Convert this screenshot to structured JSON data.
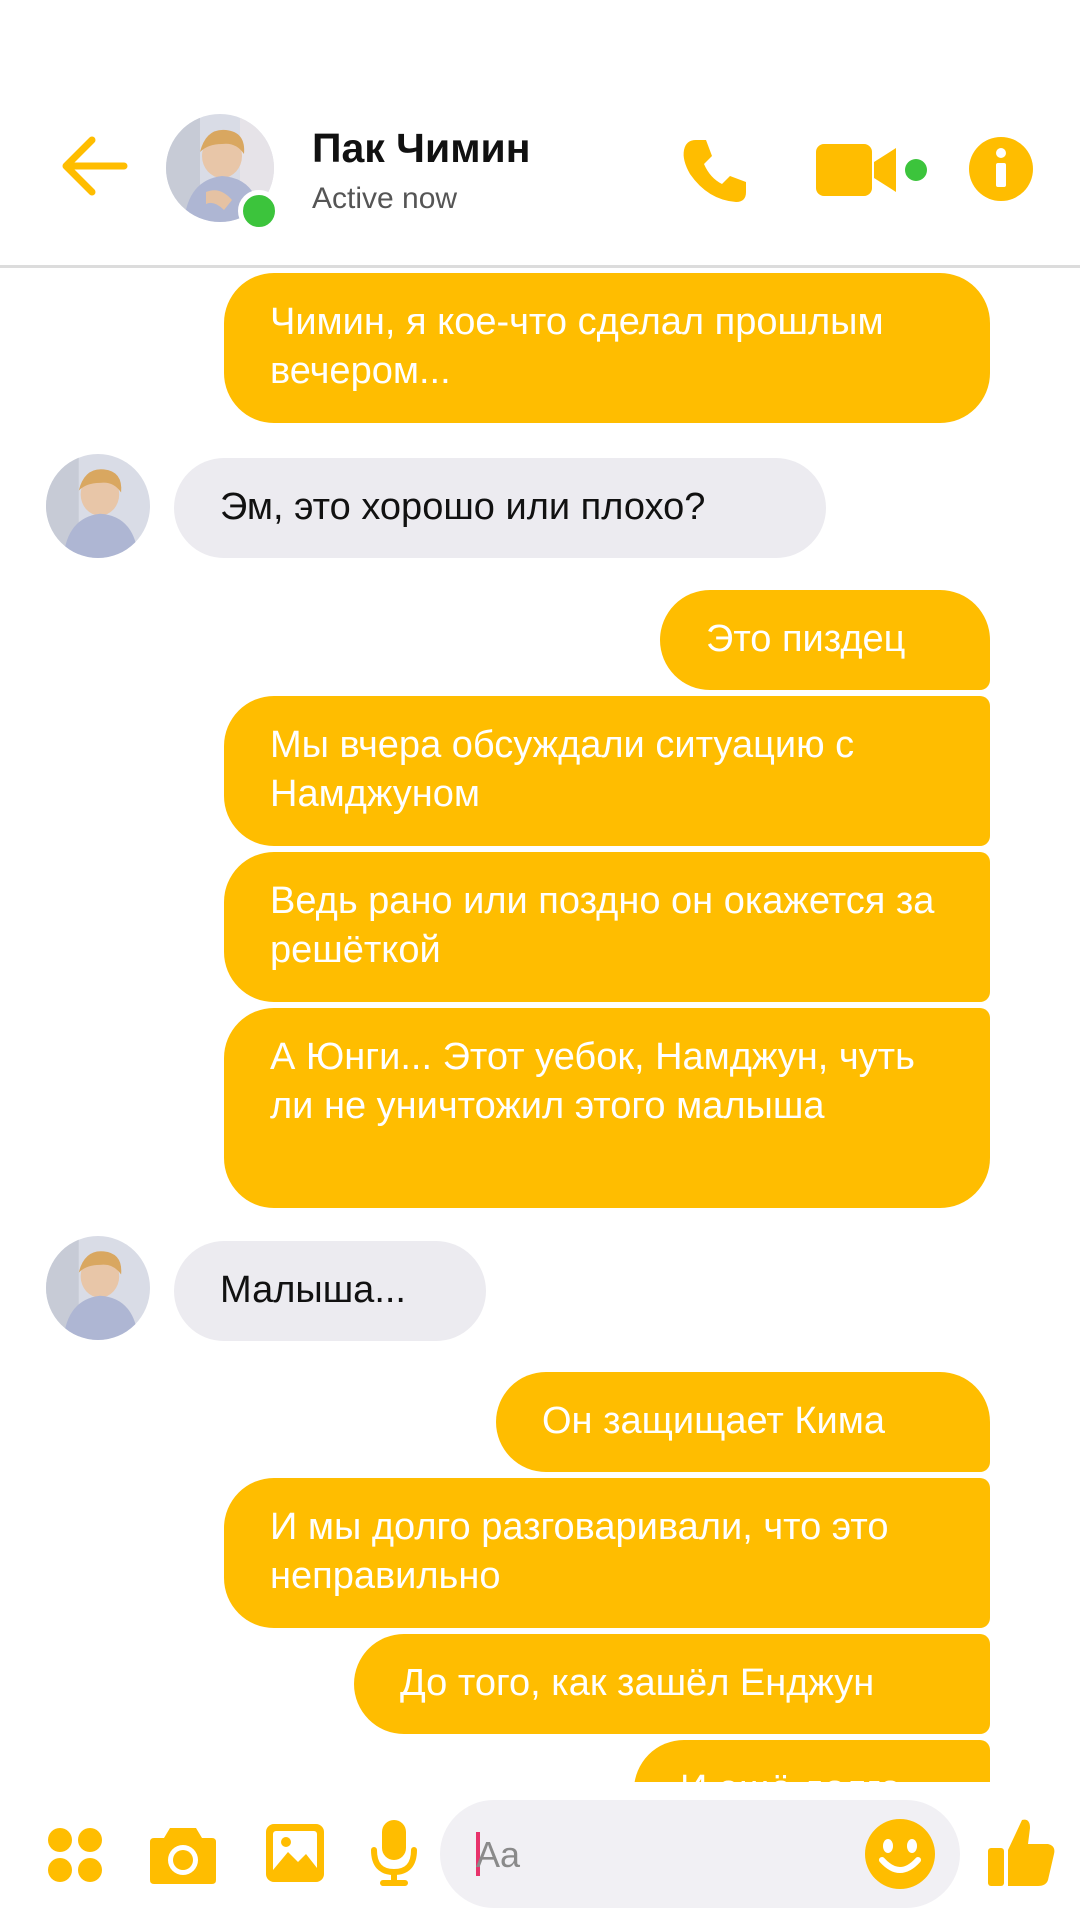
{
  "header": {
    "contact_name": "Пак Чимин",
    "status": "Active now",
    "accent_color": "#ffbd00",
    "online_color": "#3cc43c",
    "icons": [
      "back-arrow-icon",
      "phone-icon",
      "video-camera-icon",
      "info-icon"
    ]
  },
  "messages": [
    {
      "side": "out",
      "text": "Чимин, я кое-что сделал прошлым вечером..."
    },
    {
      "side": "in",
      "text": "Эм, это хорошо или плохо?"
    },
    {
      "side": "out",
      "text": "Это пиздец"
    },
    {
      "side": "out",
      "text": "Мы вчера обсуждали ситуацию с Намджуном"
    },
    {
      "side": "out",
      "text": "Ведь рано или поздно он окажется за решёткой"
    },
    {
      "side": "out",
      "text": "А Юнги... Этот уебок, Намджун, чуть ли не уничтожил этого малыша"
    },
    {
      "side": "in",
      "text": "Малыша..."
    },
    {
      "side": "out",
      "text": "Он защищает Кима"
    },
    {
      "side": "out",
      "text": "И мы долго разговаривали, что это неправильно"
    },
    {
      "side": "out",
      "text": "До того, как зашёл Енджун"
    },
    {
      "side": "out",
      "text": "И ещё долго"
    }
  ],
  "composer": {
    "placeholder": "Aa",
    "icons": [
      "apps-icon",
      "camera-icon",
      "image-icon",
      "microphone-icon",
      "emoji-icon",
      "thumbs-up-icon"
    ]
  }
}
